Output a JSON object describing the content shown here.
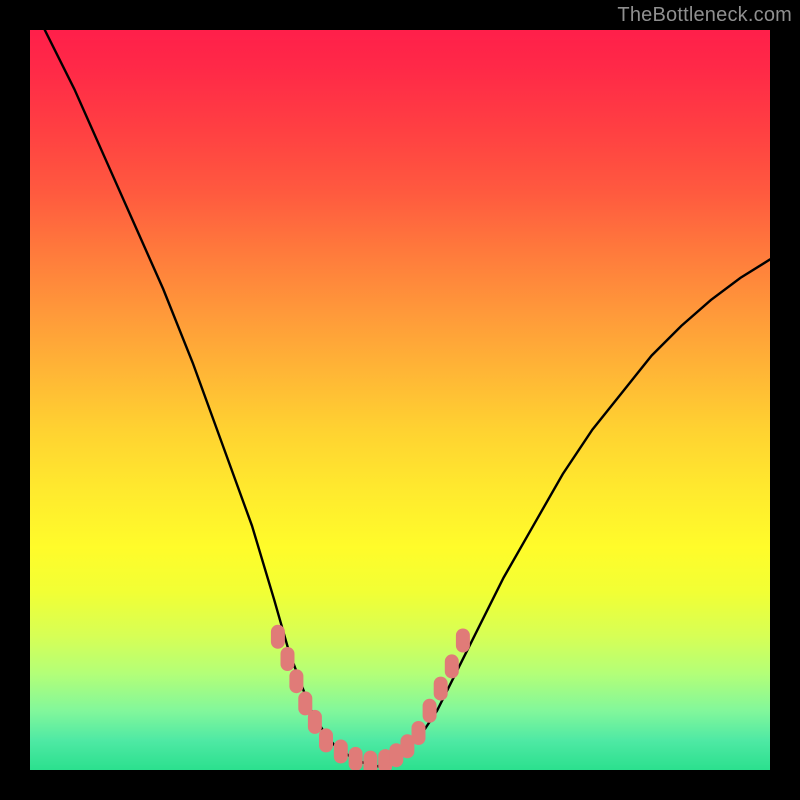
{
  "watermark": "TheBottleneck.com",
  "chart_data": {
    "type": "line",
    "title": "",
    "xlabel": "",
    "ylabel": "",
    "ylim": [
      0,
      100
    ],
    "xlim": [
      0,
      100
    ],
    "series": [
      {
        "name": "left-curve",
        "x": [
          2,
          6,
          10,
          14,
          18,
          22,
          26,
          30,
          33,
          35,
          36.5,
          38,
          39.5,
          41,
          43,
          45,
          47
        ],
        "y": [
          100,
          92,
          83,
          74,
          65,
          55,
          44,
          33,
          23,
          16,
          12,
          8,
          5.5,
          3.5,
          2,
          1,
          0.5
        ]
      },
      {
        "name": "right-curve",
        "x": [
          47,
          49,
          51,
          53,
          55,
          57,
          60,
          64,
          68,
          72,
          76,
          80,
          84,
          88,
          92,
          96,
          100
        ],
        "y": [
          0.5,
          1.5,
          3,
          5,
          8,
          12,
          18,
          26,
          33,
          40,
          46,
          51,
          56,
          60,
          63.5,
          66.5,
          69
        ]
      },
      {
        "name": "markers",
        "points_xy": [
          [
            33.5,
            18
          ],
          [
            34.8,
            15
          ],
          [
            36,
            12
          ],
          [
            37.2,
            9
          ],
          [
            38.5,
            6.5
          ],
          [
            40,
            4
          ],
          [
            42,
            2.5
          ],
          [
            44,
            1.5
          ],
          [
            46,
            1
          ],
          [
            48,
            1.2
          ],
          [
            49.5,
            2
          ],
          [
            51,
            3.2
          ],
          [
            52.5,
            5
          ],
          [
            54,
            8
          ],
          [
            55.5,
            11
          ],
          [
            57,
            14
          ],
          [
            58.5,
            17.5
          ]
        ]
      }
    ],
    "background_gradient": {
      "top": "#ff1f4a",
      "mid": "#ffe92e",
      "bottom": "#2be08e"
    }
  }
}
